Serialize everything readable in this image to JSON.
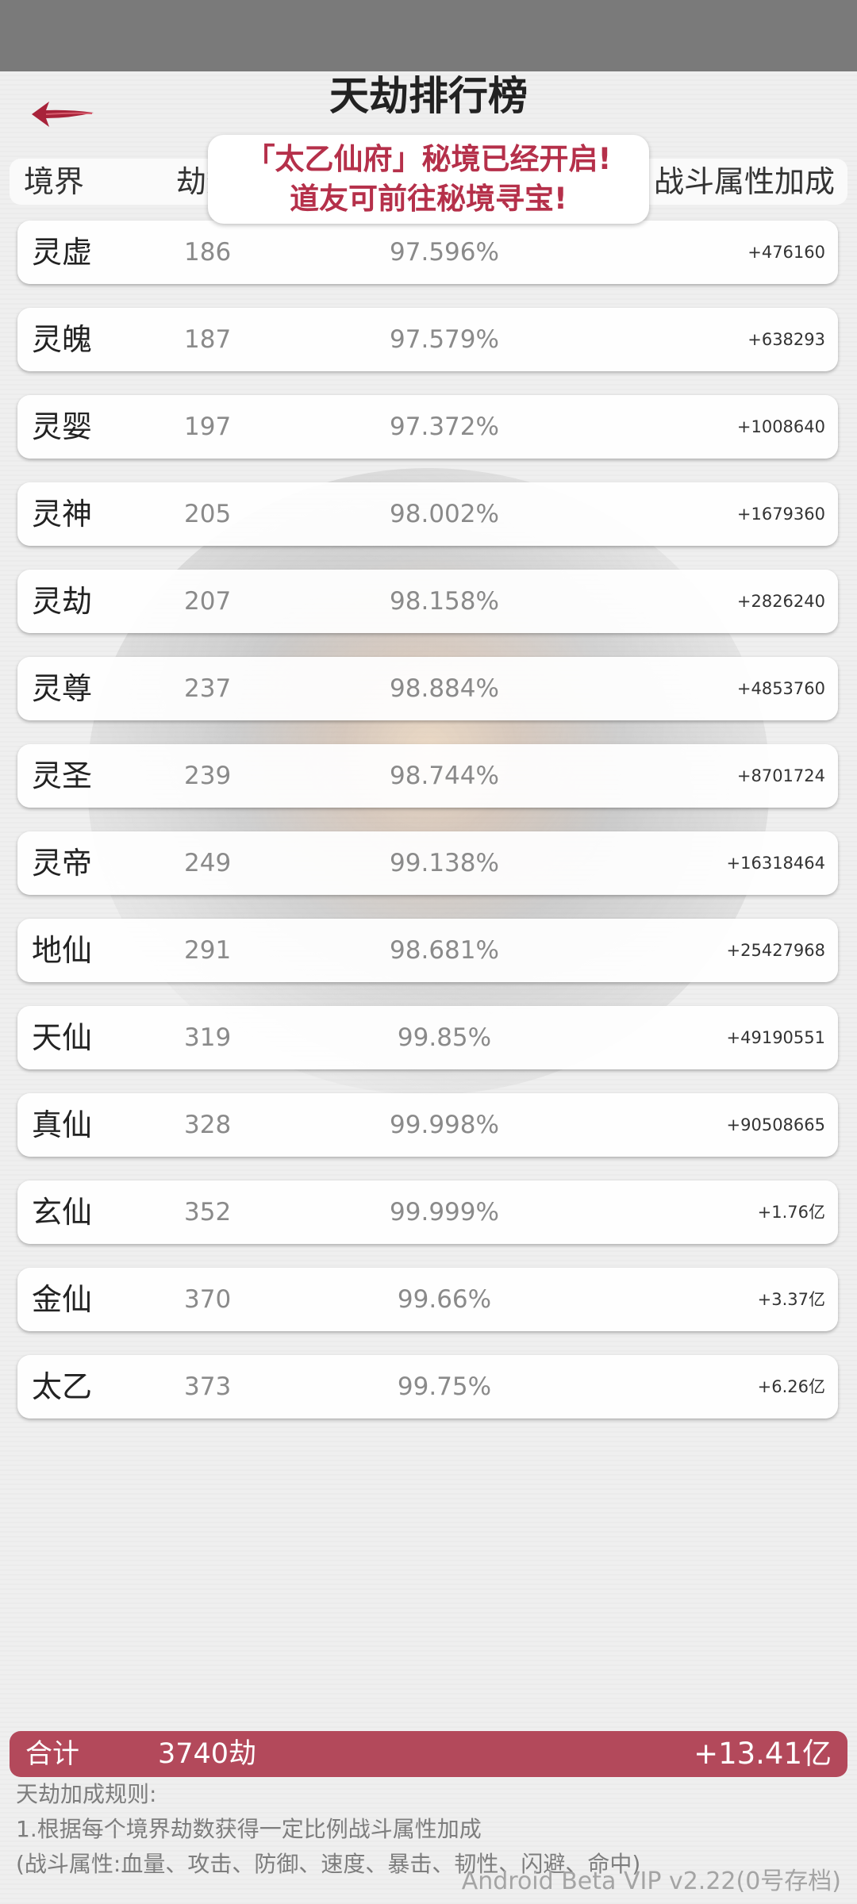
{
  "title": "天劫排行榜",
  "header": {
    "realm": "境界",
    "count": "劫数",
    "bonus": "战斗属性加成"
  },
  "notice": {
    "line1": "「太乙仙府」秘境已经开启!",
    "line2": "道友可前往秘境寻宝!"
  },
  "rows": [
    {
      "realm": "灵虚",
      "count": "186",
      "rate": "97.596%",
      "bonus": "+476160"
    },
    {
      "realm": "灵魄",
      "count": "187",
      "rate": "97.579%",
      "bonus": "+638293"
    },
    {
      "realm": "灵婴",
      "count": "197",
      "rate": "97.372%",
      "bonus": "+1008640"
    },
    {
      "realm": "灵神",
      "count": "205",
      "rate": "98.002%",
      "bonus": "+1679360"
    },
    {
      "realm": "灵劫",
      "count": "207",
      "rate": "98.158%",
      "bonus": "+2826240"
    },
    {
      "realm": "灵尊",
      "count": "237",
      "rate": "98.884%",
      "bonus": "+4853760"
    },
    {
      "realm": "灵圣",
      "count": "239",
      "rate": "98.744%",
      "bonus": "+8701724"
    },
    {
      "realm": "灵帝",
      "count": "249",
      "rate": "99.138%",
      "bonus": "+16318464"
    },
    {
      "realm": "地仙",
      "count": "291",
      "rate": "98.681%",
      "bonus": "+25427968"
    },
    {
      "realm": "天仙",
      "count": "319",
      "rate": "99.85%",
      "bonus": "+49190551"
    },
    {
      "realm": "真仙",
      "count": "328",
      "rate": "99.998%",
      "bonus": "+90508665"
    },
    {
      "realm": "玄仙",
      "count": "352",
      "rate": "99.999%",
      "bonus": "+1.76亿"
    },
    {
      "realm": "金仙",
      "count": "370",
      "rate": "99.66%",
      "bonus": "+3.37亿"
    },
    {
      "realm": "太乙",
      "count": "373",
      "rate": "99.75%",
      "bonus": "+6.26亿"
    }
  ],
  "total": {
    "label": "合计",
    "count": "3740劫",
    "bonus": "+13.41亿"
  },
  "rules": {
    "title": "天劫加成规则:",
    "line1": "1.根据每个境界劫数获得一定比例战斗属性加成",
    "line2": "(战斗属性:血量、攻击、防御、速度、暴击、韧性、闪避、命中)"
  },
  "version": "Android Beta VIP v2.22(0号存档)",
  "colors": {
    "accent": "#b3495b",
    "notice_text": "#b5304a",
    "back_arrow": "#a8233a"
  },
  "icons": {
    "back": "back-arrow-icon"
  }
}
